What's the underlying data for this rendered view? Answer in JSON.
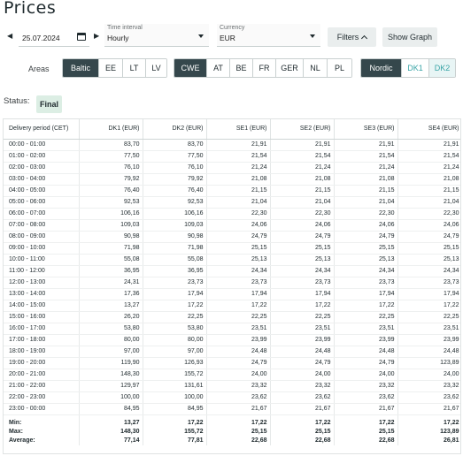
{
  "page": {
    "title": "Prices"
  },
  "toolbar": {
    "date": "25.07.2024",
    "time_interval_label": "Time interval",
    "time_interval_value": "Hourly",
    "currency_label": "Currency",
    "currency_value": "EUR",
    "filters_label": "Filters",
    "show_graph_label": "Show Graph"
  },
  "areas": {
    "label": "Areas",
    "baltic": [
      "Baltic",
      "EE",
      "LT",
      "LV"
    ],
    "cwe": [
      "CWE",
      "AT",
      "BE",
      "FR",
      "GER",
      "NL",
      "PL"
    ],
    "nordic": [
      "Nordic",
      "DK1",
      "DK2"
    ]
  },
  "status": {
    "label": "Status:",
    "value": "Final"
  },
  "table": {
    "columns": [
      "Delivery period (CET)",
      "DK1 (EUR)",
      "DK2 (EUR)",
      "SE1 (EUR)",
      "SE2 (EUR)",
      "SE3 (EUR)",
      "SE4 (EUR)"
    ],
    "rows": [
      [
        "00:00 - 01:00",
        "83,70",
        "83,70",
        "21,91",
        "21,91",
        "21,91",
        "21,91"
      ],
      [
        "01:00 - 02:00",
        "77,50",
        "77,50",
        "21,54",
        "21,54",
        "21,54",
        "21,54"
      ],
      [
        "02:00 - 03:00",
        "76,10",
        "76,10",
        "21,24",
        "21,24",
        "21,24",
        "21,24"
      ],
      [
        "03:00 - 04:00",
        "79,92",
        "79,92",
        "21,08",
        "21,08",
        "21,08",
        "21,08"
      ],
      [
        "04:00 - 05:00",
        "76,40",
        "76,40",
        "21,15",
        "21,15",
        "21,15",
        "21,15"
      ],
      [
        "05:00 - 06:00",
        "92,53",
        "92,53",
        "21,04",
        "21,04",
        "21,04",
        "21,04"
      ],
      [
        "06:00 - 07:00",
        "106,16",
        "106,16",
        "22,30",
        "22,30",
        "22,30",
        "22,30"
      ],
      [
        "07:00 - 08:00",
        "109,03",
        "109,03",
        "24,06",
        "24,06",
        "24,06",
        "24,06"
      ],
      [
        "08:00 - 09:00",
        "90,98",
        "90,98",
        "24,79",
        "24,79",
        "24,79",
        "24,79"
      ],
      [
        "09:00 - 10:00",
        "71,98",
        "71,98",
        "25,15",
        "25,15",
        "25,15",
        "25,15"
      ],
      [
        "10:00 - 11:00",
        "55,08",
        "55,08",
        "25,13",
        "25,13",
        "25,13",
        "25,13"
      ],
      [
        "11:00 - 12:00",
        "36,95",
        "36,95",
        "24,34",
        "24,34",
        "24,34",
        "24,34"
      ],
      [
        "12:00 - 13:00",
        "24,31",
        "23,73",
        "23,73",
        "23,73",
        "23,73",
        "23,73"
      ],
      [
        "13:00 - 14:00",
        "17,36",
        "17,94",
        "17,94",
        "17,94",
        "17,94",
        "17,94"
      ],
      [
        "14:00 - 15:00",
        "13,27",
        "17,22",
        "17,22",
        "17,22",
        "17,22",
        "17,22"
      ],
      [
        "15:00 - 16:00",
        "26,20",
        "22,25",
        "22,25",
        "22,25",
        "22,25",
        "22,25"
      ],
      [
        "16:00 - 17:00",
        "53,80",
        "53,80",
        "23,51",
        "23,51",
        "23,51",
        "23,51"
      ],
      [
        "17:00 - 18:00",
        "80,00",
        "80,00",
        "23,99",
        "23,99",
        "23,99",
        "23,99"
      ],
      [
        "18:00 - 19:00",
        "97,00",
        "97,00",
        "24,48",
        "24,48",
        "24,48",
        "24,48"
      ],
      [
        "19:00 - 20:00",
        "119,90",
        "126,93",
        "24,79",
        "24,79",
        "24,79",
        "123,89"
      ],
      [
        "20:00 - 21:00",
        "148,30",
        "155,72",
        "24,00",
        "24,00",
        "24,00",
        "24,00"
      ],
      [
        "21:00 - 22:00",
        "129,97",
        "131,61",
        "23,32",
        "23,32",
        "23,32",
        "23,32"
      ],
      [
        "22:00 - 23:00",
        "100,00",
        "100,00",
        "23,62",
        "23,62",
        "23,62",
        "23,62"
      ],
      [
        "23:00 - 00:00",
        "84,95",
        "84,95",
        "21,67",
        "21,67",
        "21,67",
        "21,67"
      ]
    ],
    "summary": [
      [
        "Min:",
        "13,27",
        "17,22",
        "17,22",
        "17,22",
        "17,22",
        "17,22"
      ],
      [
        "Max:",
        "148,30",
        "155,72",
        "25,15",
        "25,15",
        "25,15",
        "123,89"
      ],
      [
        "Average:",
        "77,14",
        "77,81",
        "22,68",
        "22,68",
        "22,68",
        "26,81"
      ]
    ]
  }
}
